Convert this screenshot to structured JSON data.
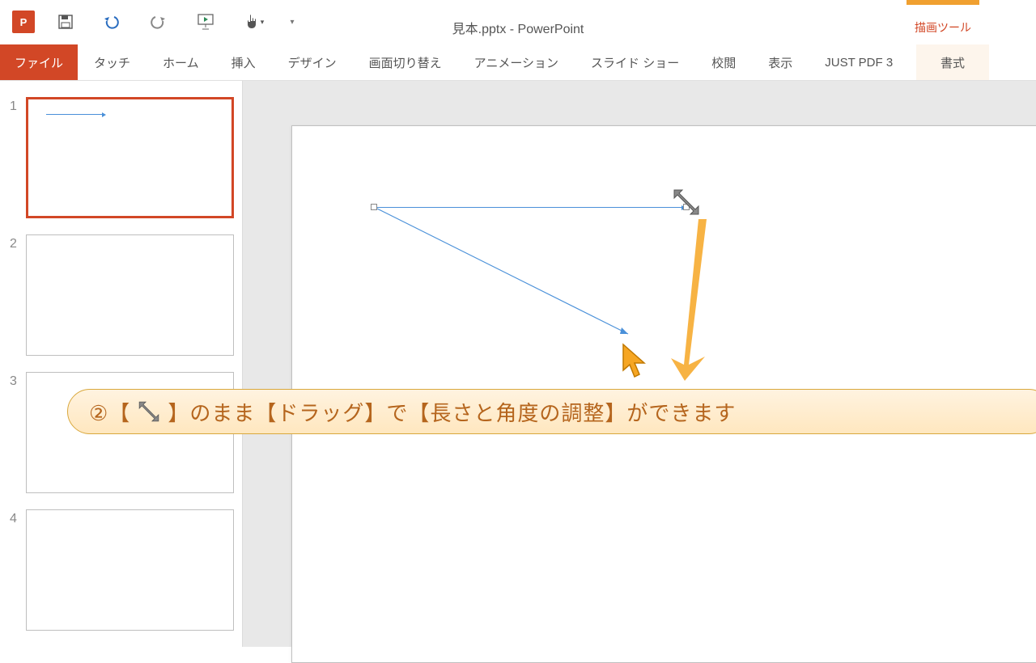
{
  "app": {
    "title": "見本.pptx - PowerPoint",
    "icon_label": "P",
    "tool_tab": "描画ツール"
  },
  "ribbon": {
    "file": "ファイル",
    "tabs": [
      "タッチ",
      "ホーム",
      "挿入",
      "デザイン",
      "画面切り替え",
      "アニメーション",
      "スライド ショー",
      "校閲",
      "表示",
      "JUST PDF 3"
    ],
    "context_tab": "書式"
  },
  "thumbnails": {
    "selected_index": 1,
    "slides": [
      1,
      2,
      3,
      4
    ]
  },
  "annotation": {
    "prefix": "②【",
    "mid1": "】のまま【ドラッグ】で【長さと角度の調整】ができます"
  },
  "colors": {
    "accent": "#d24726",
    "line": "#4a90d9",
    "callout_text": "#b5651d",
    "orange": "#f6a623"
  }
}
